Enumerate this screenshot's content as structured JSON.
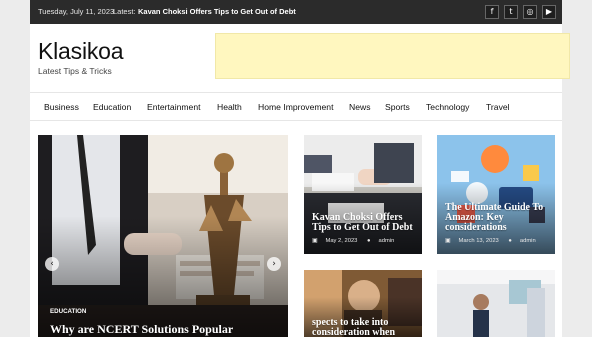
{
  "topbar": {
    "date": "Tuesday, July 11, 2023",
    "latest_label": "Latest:",
    "latest_headline": "Kavan Choksi Offers Tips to Get Out of Debt",
    "social": [
      {
        "name": "facebook-icon",
        "glyph": "f"
      },
      {
        "name": "twitter-icon",
        "glyph": "t"
      },
      {
        "name": "instagram-icon",
        "glyph": "◎"
      },
      {
        "name": "youtube-icon",
        "glyph": "▶"
      }
    ]
  },
  "brand": {
    "title": "Klasikoa",
    "tagline": "Latest Tips & Tricks"
  },
  "nav": {
    "items": [
      "Business",
      "Education",
      "Entertainment",
      "Health",
      "Home Improvement",
      "News",
      "Sports",
      "Technology",
      "Travel"
    ]
  },
  "hero": {
    "category": "EDUCATION",
    "title": "Why are NCERT Solutions Popular",
    "prev_glyph": "‹",
    "next_glyph": "›"
  },
  "cards": [
    {
      "title": "Kavan Choksi Offers Tips to Get Out of Debt",
      "date": "May 2, 2023",
      "author": "admin"
    },
    {
      "title": "The Ultimate Guide To Amazon: Key considerations",
      "date": "March 13, 2023",
      "author": "admin"
    },
    {
      "title": "spects to take into consideration when",
      "date": "",
      "author": ""
    },
    {
      "title": "",
      "date": "",
      "author": ""
    }
  ],
  "colors": {
    "topbar": "#2b2b2b",
    "ad_banner": "#fff7bf",
    "text_dark": "#111111"
  }
}
